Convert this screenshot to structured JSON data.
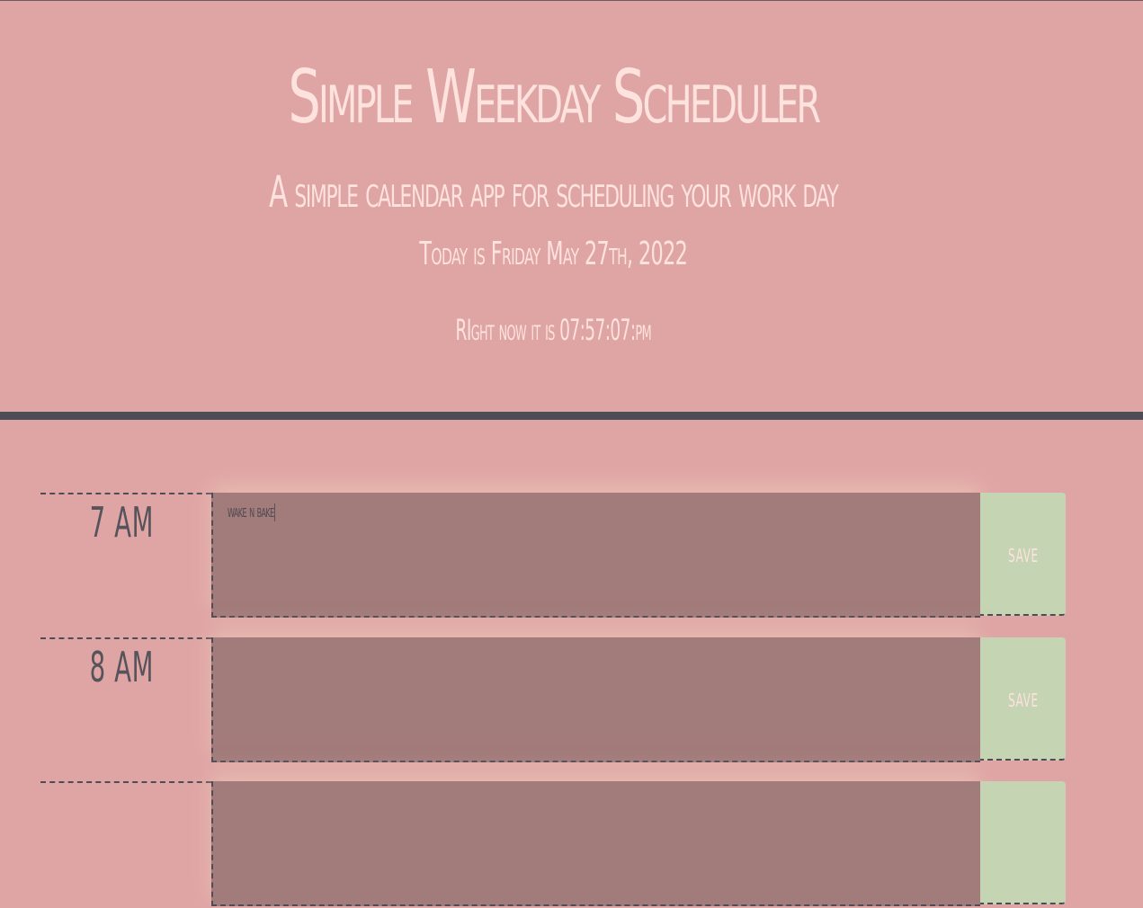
{
  "header": {
    "title": "Simple Weekday Scheduler",
    "subtitle": "A simple calendar app for scheduling your work day",
    "today": "Today is Friday May 27th, 2022",
    "clock": "RIght now it is 07:57:07:pm"
  },
  "rows": [
    {
      "hour": "7 AM",
      "task": "wake n bake",
      "save_label": "save"
    },
    {
      "hour": "8 AM",
      "task": "",
      "save_label": "save"
    },
    {
      "hour": "",
      "task": "",
      "save_label": ""
    }
  ],
  "colors": {
    "background": "#dfa5a5",
    "header_text": "#fde2de",
    "divider": "#4e4c55",
    "task_past": "#a27b7b",
    "save_button": "#c5d4b2",
    "hour_text": "#56535a"
  }
}
